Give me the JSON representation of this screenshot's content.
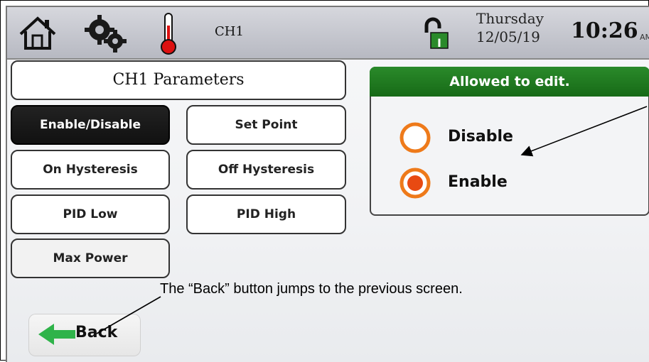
{
  "header": {
    "channel": "CH1",
    "day": "Thursday",
    "date": "12/05/19",
    "time": "10:26",
    "ampm": "AM",
    "lock_label": "I",
    "icons": [
      "home-icon",
      "gears-icon",
      "thermometer-icon",
      "unlock-icon"
    ]
  },
  "panel": {
    "title": "CH1 Parameters"
  },
  "buttons": [
    {
      "label": "Enable/Disable",
      "selected": true
    },
    {
      "label": "Set Point",
      "selected": false
    },
    {
      "label": "On Hysteresis",
      "selected": false
    },
    {
      "label": "Off Hysteresis",
      "selected": false
    },
    {
      "label": "PID Low",
      "selected": false
    },
    {
      "label": "PID High",
      "selected": false
    },
    {
      "label": "Max Power",
      "selected": false
    }
  ],
  "edit_box": {
    "header": "Allowed to edit.",
    "options": [
      {
        "label": "Disable",
        "selected": false
      },
      {
        "label": "Enable",
        "selected": true
      }
    ]
  },
  "annotation": {
    "back_note": "The “Back” button jumps to the previous screen."
  },
  "back_button": {
    "label": "Back"
  },
  "colors": {
    "accent_green": "#1f7a1f",
    "radio_orange": "#ee7a1a",
    "selected_dark": "#151515"
  }
}
